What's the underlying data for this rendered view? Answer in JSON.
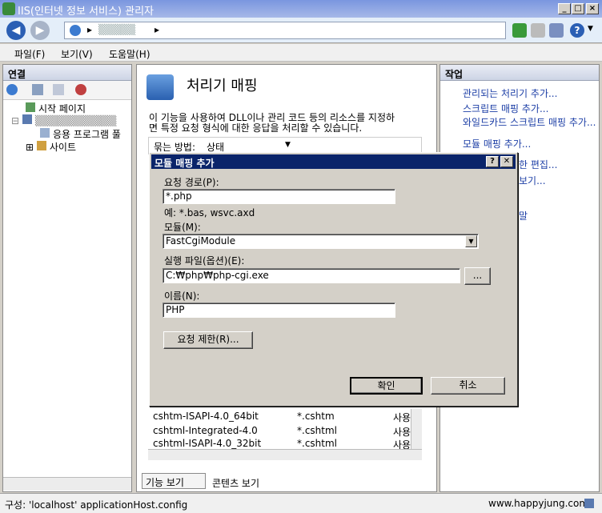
{
  "window": {
    "title": "IIS(인터넷 정보 서비스) 관리자"
  },
  "nav": {
    "address_sep": "▸",
    "address_blur": "▒▒▒▒▒"
  },
  "menu": [
    "파일(F)",
    "보기(V)",
    "도움말(H)"
  ],
  "left": {
    "header": "연결",
    "tree": [
      "시작 페이지",
      "▒▒▒▒▒▒▒▒▒▒▒",
      "응용 프로그램 풀",
      "사이트"
    ]
  },
  "center": {
    "title": "처리기 매핑",
    "desc1": "이 기능을 사용하여 DLL이나 관리 코드 등의 리소스를 지정하",
    "desc2": "면 특정 요청 형식에 대한 응답을 처리할 수 있습니다.",
    "group_label": "묶는 방법:",
    "group_value": "상태",
    "rows": [
      {
        "name": "cshtm-ISAPI-4.0_64bit",
        "path": "*.cshtm",
        "state": "사용"
      },
      {
        "name": "cshtml-Integrated-4.0",
        "path": "*.cshtml",
        "state": "사용"
      },
      {
        "name": "cshtml-ISAPI-4.0_32bit",
        "path": "*.cshtml",
        "state": "사용"
      }
    ],
    "tab_features": "기능 보기",
    "tab_content": "콘텐츠 보기"
  },
  "right": {
    "header": "작업",
    "links": [
      "관리되는 처리기 추가...",
      "스크립트 매핑 추가...",
      "와일드카드 스크립트 매핑 추가...",
      "모듈 매핑 추가...",
      "한 편집...",
      "보기...",
      "말"
    ]
  },
  "dialog": {
    "title": "모듈 매핑 추가",
    "help": "?",
    "close": "✕",
    "path_label": "요청 경로(P):",
    "path_value": "*.php",
    "example": "예: *.bas, wsvc.axd",
    "module_label": "모듈(M):",
    "module_value": "FastCgiModule",
    "exe_label": "실행 파일(옵션)(E):",
    "exe_value": "C:₩php₩php-cgi.exe",
    "browse": "...",
    "name_label": "이름(N):",
    "name_value": "PHP",
    "restrict": "요청 제한(R)...",
    "ok": "확인",
    "cancel": "취소"
  },
  "status": {
    "text": "구성: 'localhost' applicationHost.config",
    "watermark": "www.happyjung.com"
  }
}
